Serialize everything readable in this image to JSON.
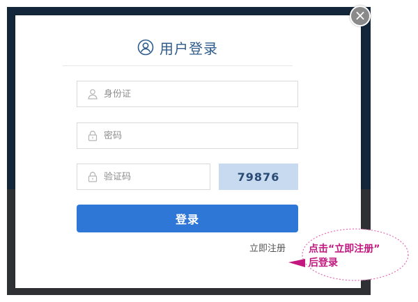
{
  "modal": {
    "title": "用户登录",
    "close_symbol": "×",
    "id_field": {
      "placeholder": "身份证",
      "value": ""
    },
    "password_field": {
      "placeholder": "密码",
      "value": ""
    },
    "captcha_field": {
      "placeholder": "验证码",
      "value": ""
    },
    "captcha_code": "79876",
    "login_label": "登录",
    "register_label": "立即注册"
  },
  "annotation": {
    "line1": "点击“立即注册”",
    "line2": "后登录"
  },
  "icons": {
    "title": "user-circle-icon",
    "id_field": "user-icon",
    "password_field": "lock-icon",
    "captcha_field": "lock-icon"
  },
  "colors": {
    "title": "#2d5b8c",
    "primary_button": "#2f77d6",
    "captcha_bg": "#c7daf0",
    "annotation_text": "#c2177e",
    "backdrop": "#13263a"
  }
}
